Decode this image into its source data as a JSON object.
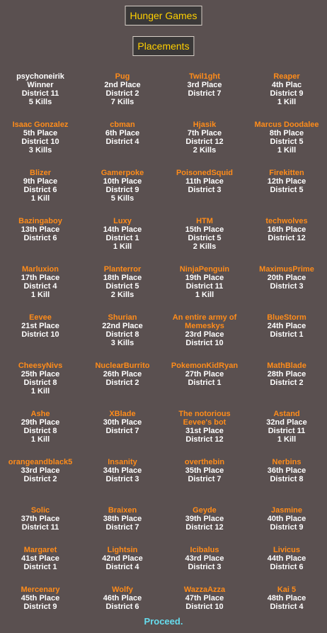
{
  "header": {
    "title": "Hunger Games",
    "subtitle": "Placements"
  },
  "tributes": [
    {
      "name": "psychoneirik",
      "place": "Winner",
      "district": "District 11",
      "kills": "5 Kills"
    },
    {
      "name": "Pug",
      "place": "2nd Place",
      "district": "District 2",
      "kills": "7 Kills"
    },
    {
      "name": "Twil1ght",
      "place": "3rd Place",
      "district": "District 7",
      "kills": ""
    },
    {
      "name": "Reaper",
      "place": "4th Plac",
      "district": "District 9",
      "kills": "1 Kill"
    },
    {
      "name": "Isaac Gonzalez",
      "place": "5th Place",
      "district": "District 10",
      "kills": "3 Kills"
    },
    {
      "name": "cbman",
      "place": "6th Place",
      "district": "District 4",
      "kills": ""
    },
    {
      "name": "Hjasik",
      "place": "7th Place",
      "district": "District 12",
      "kills": "2 Kills"
    },
    {
      "name": "Marcus Doodalee",
      "place": "8th Place",
      "district": "District 5",
      "kills": "1 Kill"
    },
    {
      "name": "Blizer",
      "place": "9th Place",
      "district": "District 6",
      "kills": "1 Kill"
    },
    {
      "name": "Gamerpoke",
      "place": "10th Place",
      "district": "District 9",
      "kills": "5 Kills"
    },
    {
      "name": "PoisonedSquid",
      "place": "11th Place",
      "district": "District 3",
      "kills": ""
    },
    {
      "name": "Firekitten",
      "place": "12th Place",
      "district": "District 5",
      "kills": ""
    },
    {
      "name": "Bazingaboy",
      "place": "13th Place",
      "district": "District 6",
      "kills": ""
    },
    {
      "name": "Luxy",
      "place": "14th Place",
      "district": "District 1",
      "kills": "1 Kill"
    },
    {
      "name": "HTM",
      "place": "15th Place",
      "district": "District 5",
      "kills": "2 Kills"
    },
    {
      "name": "techwolves",
      "place": "16th Place",
      "district": "District 12",
      "kills": ""
    },
    {
      "name": "Marluxion",
      "place": "17th Place",
      "district": "District 4",
      "kills": "1 Kill"
    },
    {
      "name": "Planterror",
      "place": "18th Place",
      "district": "District 5",
      "kills": "2 Kills"
    },
    {
      "name": "NinjaPenguin",
      "place": "19th Place",
      "district": "District 11",
      "kills": "1 Kill"
    },
    {
      "name": "MaximusPrime",
      "place": "20th Place",
      "district": "District 3",
      "kills": ""
    },
    {
      "name": "Eevee",
      "place": "21st Place",
      "district": "District 10",
      "kills": ""
    },
    {
      "name": "Shurian",
      "place": "22nd Place",
      "district": "District 8",
      "kills": "3 Kills"
    },
    {
      "name": "An entire army of Memeskys",
      "place": "23rd Place",
      "district": "District 10",
      "kills": ""
    },
    {
      "name": "BlueStorm",
      "place": "24th Place",
      "district": "District 1",
      "kills": ""
    },
    {
      "name": "CheesyNivs",
      "place": "25th Place",
      "district": "District 8",
      "kills": "1 Kill"
    },
    {
      "name": "NuclearBurrito",
      "place": "26th Place",
      "district": "District 2",
      "kills": ""
    },
    {
      "name": "PokemonKidRyan",
      "place": "27th Place",
      "district": "District 1",
      "kills": ""
    },
    {
      "name": "MathBlade",
      "place": "28th Place",
      "district": "District 2",
      "kills": ""
    },
    {
      "name": "Ashe",
      "place": "29th Place",
      "district": "District 8",
      "kills": "1 Kill"
    },
    {
      "name": "XBlade",
      "place": "30th Place",
      "district": "District 7",
      "kills": ""
    },
    {
      "name": "The notorious Eevee's bot",
      "place": "31st Place",
      "district": "District 12",
      "kills": ""
    },
    {
      "name": "Astand",
      "place": "32nd Place",
      "district": "District 11",
      "kills": "1 Kill"
    },
    {
      "name": "orangeandblack5",
      "place": "33rd Place",
      "district": "District 2",
      "kills": ""
    },
    {
      "name": "Insanity",
      "place": "34th Place",
      "district": "District 3",
      "kills": ""
    },
    {
      "name": "overthebin",
      "place": "35th Place",
      "district": "District 7",
      "kills": ""
    },
    {
      "name": "Nerbins",
      "place": "36th Place",
      "district": "District 8",
      "kills": ""
    },
    {
      "name": "Solic",
      "place": "37th Place",
      "district": "District 11",
      "kills": ""
    },
    {
      "name": "Braixen",
      "place": "38th Place",
      "district": "District 7",
      "kills": ""
    },
    {
      "name": "Geyde",
      "place": "39th Place",
      "district": "District 12",
      "kills": ""
    },
    {
      "name": "Jasmine",
      "place": "40th Place",
      "district": "District 9",
      "kills": ""
    },
    {
      "name": "Margaret",
      "place": "41st Place",
      "district": "District 1",
      "kills": ""
    },
    {
      "name": "Lightsin",
      "place": "42nd Place",
      "district": "District 4",
      "kills": ""
    },
    {
      "name": "Icibalus",
      "place": "43rd Place",
      "district": "District 3",
      "kills": ""
    },
    {
      "name": "Livicus",
      "place": "44th Place",
      "district": "District 6",
      "kills": ""
    },
    {
      "name": "Mercenary",
      "place": "45th Place",
      "district": "District 9",
      "kills": ""
    },
    {
      "name": "Wolfy",
      "place": "46th Place",
      "district": "District 6",
      "kills": ""
    },
    {
      "name": "WazzaAzza",
      "place": "47th Place",
      "district": "District 10",
      "kills": ""
    },
    {
      "name": "Kai 5",
      "place": "48th Place",
      "district": "District 4",
      "kills": ""
    }
  ],
  "footer": {
    "proceed_label": "Proceed."
  },
  "colors": {
    "background": "#5a5050",
    "name": "#ff8c1a",
    "text": "#ffffff",
    "title": "#ffd000",
    "proceed": "#66ddee"
  }
}
